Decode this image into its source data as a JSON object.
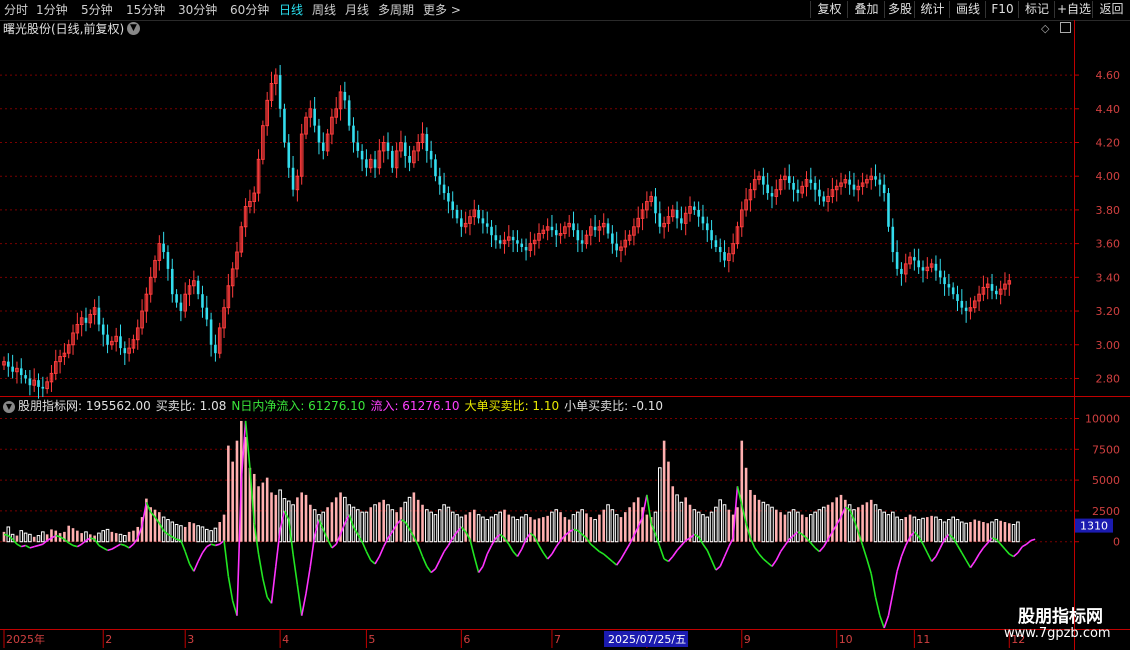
{
  "toolbar": {
    "periods": [
      {
        "label": "分时",
        "active": false
      },
      {
        "label": "1分钟",
        "active": false
      },
      {
        "label": "5分钟",
        "active": false
      },
      {
        "label": "15分钟",
        "active": false
      },
      {
        "label": "30分钟",
        "active": false
      },
      {
        "label": "60分钟",
        "active": false
      },
      {
        "label": "日线",
        "active": true
      },
      {
        "label": "周线",
        "active": false
      },
      {
        "label": "月线",
        "active": false
      },
      {
        "label": "多周期",
        "active": false
      },
      {
        "label": "更多 >",
        "active": false
      }
    ],
    "actions": [
      "复权",
      "叠加",
      "多股",
      "统计",
      "画线",
      "F10",
      "标记",
      "+自选",
      "返回"
    ]
  },
  "stock": {
    "title": "曙光股份(日线,前复权)"
  },
  "indicator": {
    "name": "股朋指标网",
    "main_value": ": 195562.00",
    "buy_sell_ratio": "买卖比: 1.08",
    "net_inflow": "N日内净流入: 61276.10",
    "inflow": "流入: 61276.10",
    "big_order_ratio": "大单买卖比: 1.10",
    "small_order_ratio": "小单买卖比: -0.10"
  },
  "crosshair": {
    "date_label": "2025/07/25/五",
    "value_label": "1310"
  },
  "watermark": {
    "title": "股朋指标网",
    "url": "www.7gpzb.com"
  },
  "colors": {
    "up": "#ff3c3c",
    "down": "#33ddee",
    "grid": "#7a0000",
    "axis": "#c00000",
    "line_green": "#22e622",
    "line_magenta": "#ff33ff",
    "vol_up": "#ffb0b0",
    "vol_down": "#ffffff",
    "date_highlight": "#1b1bb0"
  },
  "chart_data": [
    {
      "type": "candlestick",
      "title": "曙光股份(日线,前复权)",
      "y_ticks": [
        "4.60",
        "4.40",
        "4.20",
        "4.00",
        "3.80",
        "3.60",
        "3.40",
        "3.20",
        "3.00",
        "2.80"
      ],
      "ylim": [
        2.69,
        4.82
      ],
      "x_ticks": [
        "2025年",
        "2",
        "3",
        "4",
        "5",
        "6",
        "7",
        "8",
        "9",
        "10",
        "11",
        "12"
      ],
      "x_tick_positions_days": [
        0,
        23,
        42,
        64,
        84,
        106,
        127,
        149,
        171,
        193,
        211,
        233
      ],
      "days": [
        0,
        1,
        2,
        3,
        4,
        5,
        6,
        7,
        8,
        9,
        10,
        11,
        12,
        13,
        14,
        15,
        16,
        17,
        18,
        19,
        20,
        21,
        22,
        23,
        24,
        25,
        26,
        27,
        28,
        29,
        30,
        31,
        32,
        33,
        34,
        35,
        36,
        37,
        38,
        39,
        40,
        41,
        42,
        43,
        44,
        45,
        46,
        47,
        48,
        49,
        50,
        51,
        52,
        53,
        54,
        55,
        56,
        57,
        58,
        59,
        60,
        61,
        62,
        63,
        64,
        65,
        66,
        67,
        68,
        69,
        70,
        71,
        72,
        73,
        74,
        75,
        76,
        77,
        78,
        79,
        80,
        81,
        82,
        83,
        84,
        85,
        86,
        87,
        88,
        89,
        90,
        91,
        92,
        93,
        94,
        95,
        96,
        97,
        98,
        99,
        100,
        101,
        102,
        103,
        104,
        105,
        106,
        107,
        108,
        109,
        110,
        111,
        112,
        113,
        114,
        115,
        116,
        117,
        118,
        119,
        120,
        121,
        122,
        123,
        124,
        125,
        126,
        127,
        128,
        129,
        130,
        131,
        132,
        133,
        134,
        135,
        136,
        137,
        138,
        139,
        140,
        141,
        142,
        143,
        144,
        145,
        146,
        147,
        148,
        149,
        150,
        151,
        152,
        153,
        154,
        155,
        156,
        157,
        158,
        159,
        160,
        161,
        162,
        163,
        164,
        165,
        166,
        167,
        168,
        169,
        170,
        171,
        172,
        173,
        174,
        175,
        176,
        177,
        178,
        179,
        180,
        181,
        182,
        183,
        184,
        185,
        186,
        187,
        188,
        189,
        190,
        191,
        192,
        193,
        194,
        195,
        196,
        197,
        198,
        199,
        200,
        201,
        202,
        203,
        204,
        205,
        206,
        207,
        208,
        209,
        210,
        211,
        212,
        213,
        214,
        215,
        216,
        217,
        218,
        219,
        220,
        221,
        222,
        223,
        224,
        225,
        226,
        227,
        228,
        229,
        230,
        231,
        232,
        233,
        234,
        235,
        236,
        237,
        238,
        239,
        240,
        241,
        242,
        243,
        244,
        245,
        246,
        247
      ],
      "open": [
        2.88,
        2.9,
        2.87,
        2.84,
        2.86,
        2.82,
        2.8,
        2.76,
        2.79,
        2.75,
        2.74,
        2.78,
        2.83,
        2.9,
        2.93,
        2.95,
        3.0,
        3.07,
        3.12,
        3.16,
        3.13,
        3.18,
        3.22,
        3.12,
        3.06,
        3.0,
        3.02,
        3.05,
        2.98,
        2.95,
        2.98,
        3.03,
        3.1,
        3.2,
        3.3,
        3.4,
        3.5,
        3.6,
        3.55,
        3.45,
        3.3,
        3.25,
        3.2,
        3.3,
        3.35,
        3.38,
        3.3,
        3.22,
        3.15,
        3.0,
        2.95,
        3.1,
        3.22,
        3.35,
        3.45,
        3.55,
        3.7,
        3.82,
        3.85,
        3.9,
        4.1,
        4.3,
        4.45,
        4.55,
        4.6,
        4.4,
        4.2,
        4.05,
        3.92,
        4.0,
        4.25,
        4.35,
        4.4,
        4.3,
        4.2,
        4.15,
        4.25,
        4.35,
        4.4,
        4.5,
        4.45,
        4.3,
        4.2,
        4.15,
        4.1,
        4.05,
        4.1,
        4.05,
        4.15,
        4.2,
        4.15,
        4.05,
        4.15,
        4.2,
        4.12,
        4.08,
        4.15,
        4.2,
        4.25,
        4.15,
        4.1,
        4.0,
        3.95,
        3.9,
        3.85,
        3.8,
        3.75,
        3.7,
        3.72,
        3.76,
        3.8,
        3.75,
        3.72,
        3.7,
        3.65,
        3.62,
        3.6,
        3.62,
        3.64,
        3.62,
        3.6,
        3.58,
        3.56,
        3.6,
        3.62,
        3.66,
        3.68,
        3.7,
        3.68,
        3.65,
        3.66,
        3.7,
        3.72,
        3.68,
        3.62,
        3.6,
        3.65,
        3.7,
        3.68,
        3.7,
        3.72,
        3.66,
        3.6,
        3.56,
        3.58,
        3.62,
        3.65,
        3.7,
        3.75,
        3.8,
        3.85,
        3.88,
        3.78,
        3.7,
        3.72,
        3.76,
        3.8,
        3.75,
        3.72,
        3.78,
        3.82,
        3.8,
        3.76,
        3.72,
        3.68,
        3.62,
        3.58,
        3.55,
        3.5,
        3.54,
        3.6,
        3.7,
        3.8,
        3.86,
        3.92,
        3.98,
        4.0,
        3.95,
        3.9,
        3.88,
        3.92,
        3.98,
        4.0,
        3.96,
        3.92,
        3.9,
        3.94,
        3.98,
        3.96,
        3.92,
        3.88,
        3.85,
        3.88,
        3.92,
        3.94,
        3.96,
        3.98,
        3.95,
        3.92,
        3.94,
        3.96,
        3.98,
        4.0,
        3.98,
        3.95,
        3.9,
        3.7,
        3.55,
        3.45,
        3.42,
        3.48,
        3.52,
        3.5,
        3.46,
        3.44,
        3.46,
        3.48,
        3.44,
        3.4,
        3.36,
        3.34,
        3.3,
        3.26,
        3.22,
        3.2,
        3.22,
        3.26,
        3.3,
        3.34,
        3.36,
        3.32,
        3.3,
        3.33,
        3.36
      ],
      "close": [
        2.9,
        2.87,
        2.84,
        2.86,
        2.82,
        2.8,
        2.76,
        2.79,
        2.75,
        2.74,
        2.78,
        2.83,
        2.9,
        2.93,
        2.95,
        3.0,
        3.07,
        3.12,
        3.16,
        3.13,
        3.18,
        3.22,
        3.12,
        3.06,
        3.0,
        3.02,
        3.05,
        2.98,
        2.95,
        2.98,
        3.03,
        3.1,
        3.2,
        3.3,
        3.4,
        3.5,
        3.6,
        3.55,
        3.45,
        3.3,
        3.25,
        3.2,
        3.3,
        3.35,
        3.38,
        3.3,
        3.22,
        3.15,
        3.0,
        2.95,
        3.1,
        3.22,
        3.35,
        3.45,
        3.55,
        3.7,
        3.82,
        3.85,
        3.9,
        4.1,
        4.3,
        4.45,
        4.55,
        4.6,
        4.4,
        4.2,
        4.05,
        3.92,
        4.0,
        4.25,
        4.35,
        4.4,
        4.3,
        4.2,
        4.15,
        4.25,
        4.35,
        4.4,
        4.5,
        4.45,
        4.3,
        4.2,
        4.15,
        4.1,
        4.05,
        4.1,
        4.05,
        4.15,
        4.2,
        4.15,
        4.05,
        4.15,
        4.2,
        4.12,
        4.08,
        4.15,
        4.2,
        4.25,
        4.15,
        4.1,
        4.0,
        3.95,
        3.9,
        3.85,
        3.8,
        3.75,
        3.7,
        3.72,
        3.76,
        3.8,
        3.75,
        3.72,
        3.7,
        3.65,
        3.62,
        3.6,
        3.62,
        3.64,
        3.62,
        3.6,
        3.58,
        3.56,
        3.6,
        3.62,
        3.66,
        3.68,
        3.7,
        3.68,
        3.65,
        3.66,
        3.7,
        3.72,
        3.68,
        3.62,
        3.6,
        3.65,
        3.7,
        3.68,
        3.7,
        3.72,
        3.66,
        3.6,
        3.56,
        3.58,
        3.62,
        3.65,
        3.7,
        3.75,
        3.8,
        3.85,
        3.88,
        3.78,
        3.7,
        3.72,
        3.76,
        3.8,
        3.75,
        3.72,
        3.78,
        3.82,
        3.8,
        3.76,
        3.72,
        3.68,
        3.62,
        3.58,
        3.55,
        3.5,
        3.54,
        3.6,
        3.7,
        3.8,
        3.86,
        3.92,
        3.98,
        4.0,
        3.95,
        3.9,
        3.88,
        3.92,
        3.98,
        4.0,
        3.96,
        3.92,
        3.9,
        3.94,
        3.98,
        3.96,
        3.92,
        3.88,
        3.85,
        3.88,
        3.92,
        3.94,
        3.96,
        3.98,
        3.95,
        3.92,
        3.94,
        3.96,
        3.98,
        4.0,
        3.98,
        3.95,
        3.9,
        3.7,
        3.55,
        3.45,
        3.42,
        3.48,
        3.52,
        3.5,
        3.46,
        3.44,
        3.46,
        3.48,
        3.44,
        3.4,
        3.36,
        3.34,
        3.3,
        3.26,
        3.22,
        3.2,
        3.22,
        3.26,
        3.3,
        3.34,
        3.36,
        3.32,
        3.3,
        3.33,
        3.36,
        3.38
      ]
    },
    {
      "type": "bar+line",
      "title": "股朋指标网",
      "y_ticks": [
        "10000",
        "7500",
        "5000",
        "2500",
        "0"
      ],
      "ylim": [
        -7000,
        11500
      ],
      "volume_bars": [
        800,
        1200,
        600,
        500,
        900,
        700,
        600,
        400,
        500,
        800,
        600,
        1000,
        900,
        700,
        800,
        1300,
        1100,
        900,
        700,
        800,
        600,
        500,
        700,
        900,
        1000,
        800,
        700,
        600,
        500,
        800,
        900,
        1200,
        2000,
        3500,
        2800,
        2600,
        2400,
        2000,
        1800,
        1600,
        1400,
        1300,
        1200,
        1600,
        1500,
        1300,
        1200,
        1000,
        900,
        1100,
        1600,
        2200,
        7800,
        6500,
        8200,
        9800,
        8500,
        6000,
        5500,
        4500,
        4800,
        5200,
        4000,
        3800,
        4200,
        3500,
        3300,
        3000,
        3600,
        4000,
        3800,
        3000,
        2600,
        2200,
        2400,
        2800,
        3200,
        3600,
        4000,
        3600,
        3000,
        2800,
        2600,
        2400,
        2400,
        2800,
        3000,
        3200,
        3400,
        3000,
        2600,
        2400,
        2800,
        3200,
        3600,
        4000,
        3400,
        3000,
        2600,
        2400,
        2200,
        2600,
        3000,
        2800,
        2400,
        2200,
        2000,
        2200,
        2400,
        2600,
        2200,
        2000,
        1800,
        2000,
        2200,
        2400,
        2600,
        2200,
        2000,
        1800,
        2000,
        2200,
        2000,
        1800,
        1900,
        2000,
        2100,
        2400,
        2600,
        2400,
        2000,
        1800,
        2200,
        2400,
        2600,
        2300,
        2000,
        1800,
        2200,
        2600,
        3000,
        2600,
        2200,
        2000,
        2400,
        2800,
        3200,
        3600,
        2800,
        2200,
        2000,
        2400,
        6000,
        8200,
        6500,
        4500,
        3800,
        3200,
        3600,
        3000,
        2600,
        2400,
        2200,
        2000,
        2400,
        2800,
        3400,
        3000,
        2600,
        2200,
        2800,
        8200,
        6000,
        4200,
        3800,
        3400,
        3200,
        3000,
        2800,
        2600,
        2400,
        2200,
        2400,
        2600,
        2400,
        2200,
        2000,
        2200,
        2400,
        2600,
        2800,
        3000,
        3200,
        3600,
        3800,
        3400,
        3000,
        2600,
        2800,
        3000,
        3200,
        3400,
        3000,
        2600,
        2400,
        2200,
        2400,
        2000,
        1800,
        2000,
        2200,
        2000,
        1800,
        1900,
        2000,
        2100,
        2000,
        1800,
        1600,
        1800,
        2000,
        1800,
        1600,
        1500,
        1600,
        1800,
        1700,
        1600,
        1500,
        1600,
        1800,
        1700,
        1600,
        1500,
        1400,
        1600
      ],
      "line_values": [
        600,
        500,
        200,
        -200,
        -400,
        -300,
        -500,
        -400,
        -300,
        -200,
        100,
        300,
        500,
        400,
        200,
        -100,
        -300,
        -400,
        -200,
        100,
        300,
        200,
        -300,
        -500,
        -700,
        -600,
        -400,
        -200,
        -300,
        -500,
        -200,
        300,
        1300,
        3200,
        2400,
        2000,
        1500,
        900,
        600,
        400,
        200,
        100,
        -800,
        -1800,
        -2400,
        -1600,
        -900,
        -400,
        -200,
        -300,
        -200,
        100,
        -2800,
        -4800,
        -6000,
        5000,
        9800,
        6000,
        1500,
        -1000,
        -3000,
        -4500,
        -5000,
        -2000,
        1000,
        2500,
        1800,
        -1000,
        -3500,
        -6000,
        -4200,
        -2000,
        500,
        1800,
        1000,
        200,
        -500,
        -200,
        600,
        1500,
        2200,
        1200,
        600,
        0,
        -800,
        -1500,
        -1800,
        -1200,
        -400,
        300,
        800,
        1400,
        1800,
        1600,
        1000,
        400,
        -300,
        -1200,
        -2000,
        -2500,
        -2200,
        -1500,
        -800,
        -300,
        300,
        800,
        1200,
        800,
        200,
        -1200,
        -2500,
        -2000,
        -1000,
        -300,
        300,
        600,
        300,
        -200,
        -800,
        -1200,
        -600,
        200,
        700,
        400,
        -300,
        -900,
        -1400,
        -1000,
        -400,
        100,
        500,
        800,
        1000,
        900,
        600,
        300,
        -200,
        -500,
        -800,
        -1000,
        -1300,
        -1600,
        -1900,
        -1400,
        -800,
        -200,
        500,
        1200,
        2000,
        3800,
        1500,
        600,
        -400,
        -1400,
        -1600,
        -1200,
        -700,
        -300,
        100,
        300,
        600,
        400,
        -200,
        -700,
        -1500,
        -2300,
        -2000,
        -1200,
        -400,
        300,
        4500,
        3000,
        1500,
        300,
        -500,
        -1000,
        -1400,
        -1700,
        -2000,
        -1500,
        -800,
        -300,
        200,
        500,
        800,
        600,
        300,
        -100,
        -500,
        -800,
        -400,
        200,
        800,
        1400,
        2000,
        2800,
        2600,
        1800,
        800,
        -300,
        -1400,
        -2600,
        -4500,
        -6000,
        -7000,
        -6000,
        -4200,
        -2400,
        -1200,
        -300,
        400,
        800,
        400,
        -200,
        -900,
        -1600,
        -1200,
        -500,
        200,
        600,
        300,
        -300,
        -900,
        -1500,
        -2100,
        -1600,
        -1000,
        -500,
        -100,
        300,
        200,
        -200,
        -600,
        -1000,
        -1200,
        -900,
        -400,
        -200,
        100,
        200
      ]
    }
  ]
}
